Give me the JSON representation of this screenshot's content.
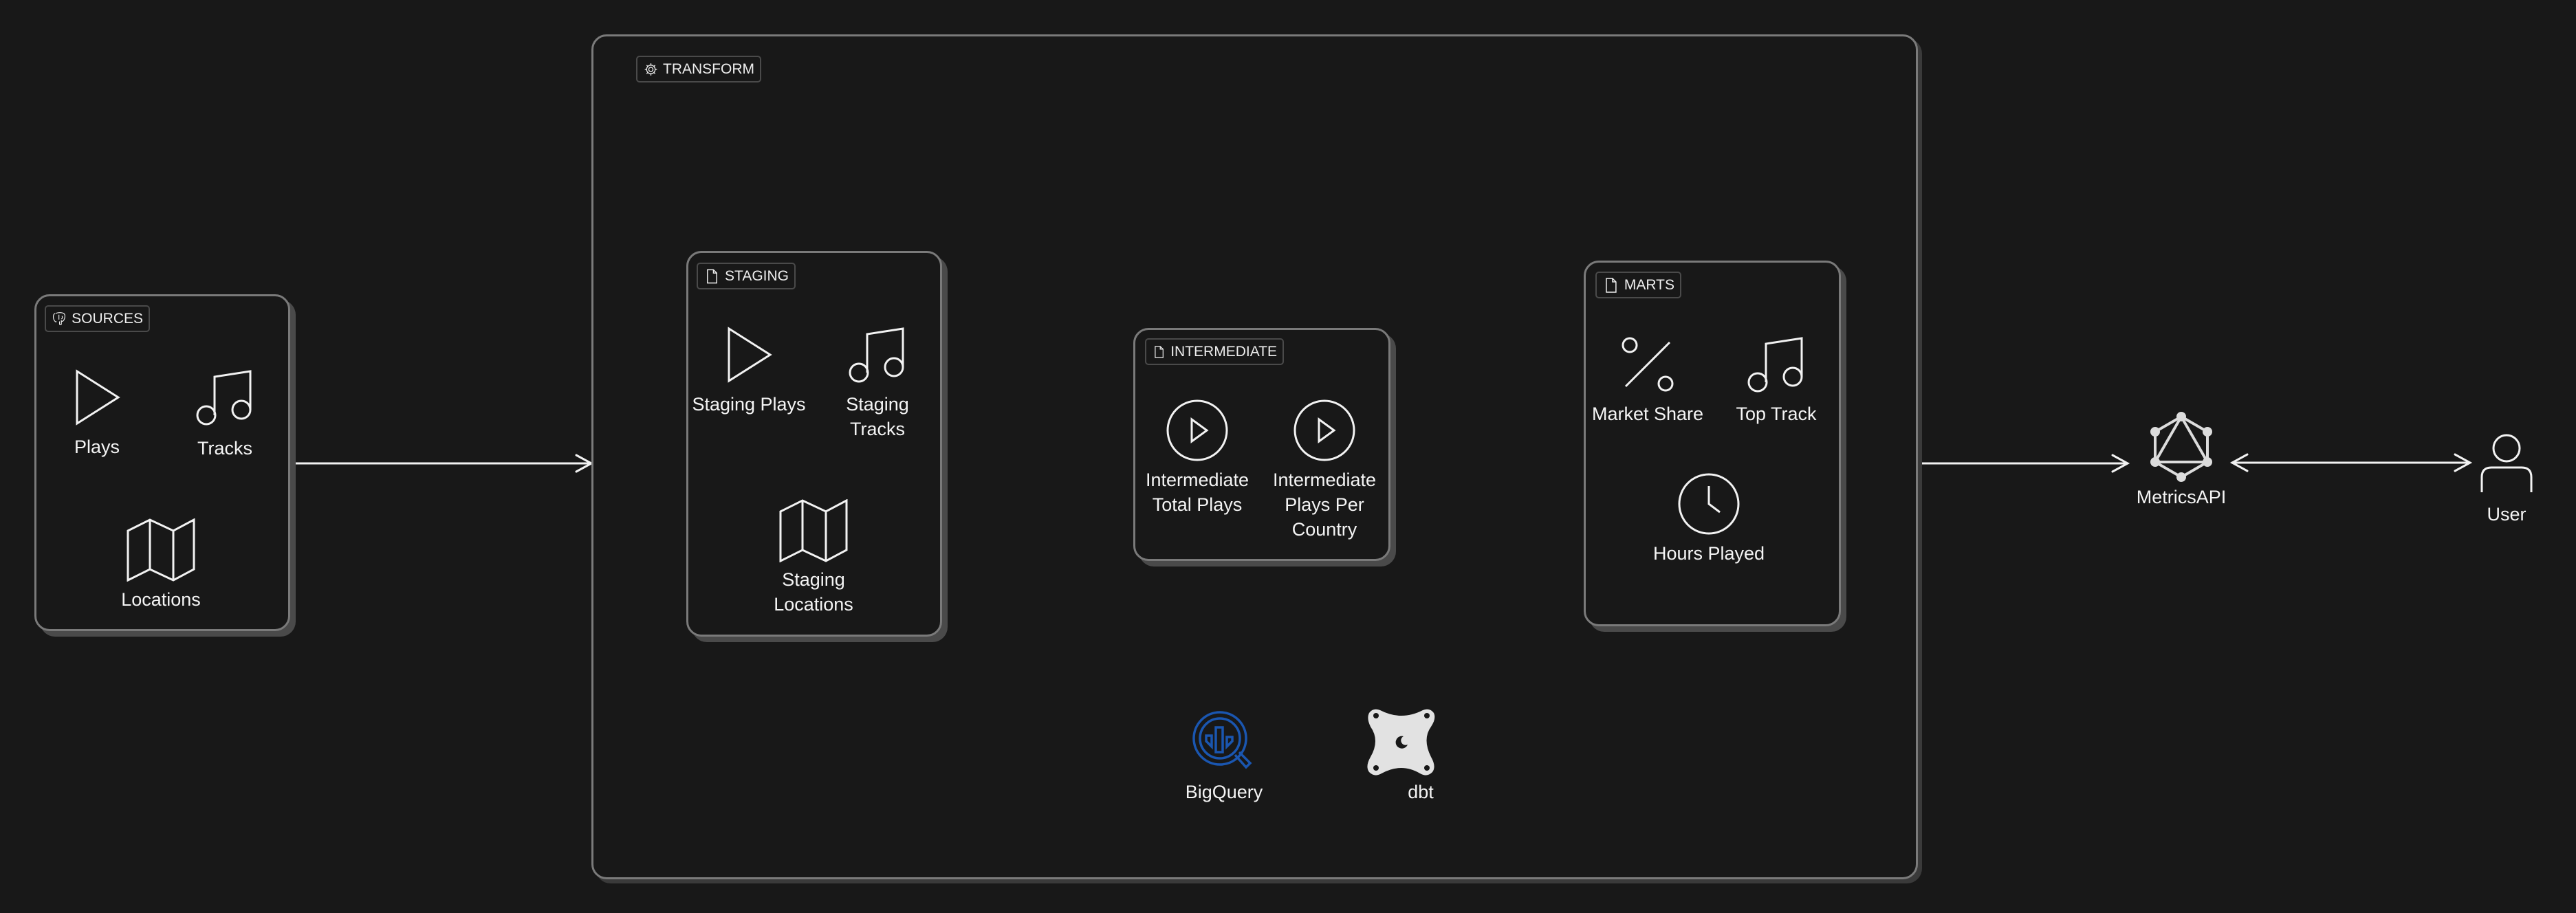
{
  "sources": {
    "tag": "SOURCES",
    "items": [
      "Plays",
      "Tracks",
      "Locations"
    ]
  },
  "transform": {
    "tag": "TRANSFORM",
    "tools": [
      "BigQuery",
      "dbt"
    ]
  },
  "staging": {
    "tag": "STAGING",
    "items": [
      "Staging Plays",
      "Staging\nTracks",
      "Staging\nLocations"
    ]
  },
  "intermediate": {
    "tag": "INTERMEDIATE",
    "items": [
      "Intermediate\nTotal Plays",
      "Intermediate\nPlays Per\nCountry"
    ]
  },
  "marts": {
    "tag": "MARTS",
    "items": [
      "Market Share",
      "Top Track",
      "Hours Played"
    ]
  },
  "api": {
    "label": "MetricsAPI"
  },
  "user": {
    "label": "User"
  },
  "colors": {
    "background": "#181818",
    "stroke": "#f2f2f2",
    "bigquery": "#1a56b0"
  }
}
